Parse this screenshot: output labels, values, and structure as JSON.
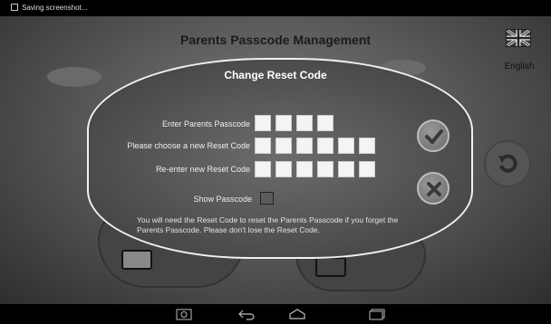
{
  "status_bar": {
    "notification": "Saving screenshot..."
  },
  "header": {
    "title": "Parents Passcode Management",
    "language": "English"
  },
  "dialog": {
    "title": "Change Reset Code",
    "fields": [
      {
        "label": "Enter Parents Passcode",
        "boxes": 4
      },
      {
        "label": "Please choose a new Reset Code",
        "boxes": 6
      },
      {
        "label": "Re-enter new Reset Code",
        "boxes": 6
      }
    ],
    "show_passcode_label": "Show Passcode",
    "show_passcode_checked": false,
    "note": "You will need the Reset Code to reset the Parents Passcode if you forget the Parents Passcode. Please don't lose the Reset Code."
  },
  "icons": {
    "confirm": "checkmark-icon",
    "cancel": "close-icon",
    "back": "undo-icon",
    "flag": "uk-flag-icon",
    "nav": [
      "screenshot-icon",
      "back-icon",
      "home-icon",
      "recents-icon"
    ]
  }
}
